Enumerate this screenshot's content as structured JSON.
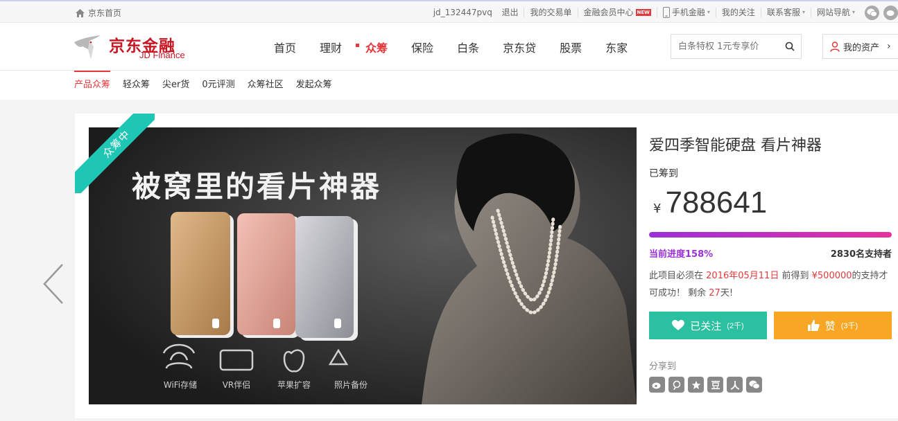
{
  "topbar": {
    "home_label": "京东首页",
    "username": "jd_132447pvq",
    "logout": "退出",
    "my_orders": "我的交易单",
    "vip_center": "金融会员中心",
    "new_badge": "NEW",
    "mobile": "手机金融",
    "my_follow": "我的关注",
    "service": "联系客服",
    "site_nav": "网站导航"
  },
  "header": {
    "logo_cn": "京东金融",
    "logo_en": "JD Finance",
    "nav": [
      "首页",
      "理财",
      "众筹",
      "保险",
      "白条",
      "京东贷",
      "股票",
      "东家"
    ],
    "search_placeholder": "白条特权 1元专享价",
    "my_assets": "我的资产"
  },
  "subnav": [
    "产品众筹",
    "轻众筹",
    "尖er货",
    "0元评测",
    "众筹社区",
    "发起众筹"
  ],
  "banner": {
    "ribbon": "众筹中",
    "headline": "被窝里的看片神器",
    "features": [
      "WiFi存储",
      "VR伴侣",
      "苹果扩容",
      "照片备份"
    ]
  },
  "project": {
    "title": "爱四季智能硬盘 看片神器",
    "raised_label": "已筹到",
    "currency": "¥",
    "amount": "788641",
    "progress_fraction": 1.0,
    "progress_text": "当前进度158%",
    "supporters": "2830名支持者",
    "desc_prefix": "此项目必须在",
    "deadline": "2016年05月11日",
    "desc_mid": "前得到",
    "target": "¥500000",
    "desc_suffix": "的支持才可成功！ 剩余",
    "days_left": "27",
    "days_unit": "天!",
    "follow_label": "已关注",
    "follow_count": "(2千)",
    "like_label": "赞",
    "like_count": "(3千)",
    "share_label": "分享到"
  },
  "colors": {
    "brand_red": "#c91623",
    "accent_red": "#e4393c",
    "teal": "#2bc0a0",
    "orange": "#f8a623",
    "purple": "#9b30d8"
  }
}
